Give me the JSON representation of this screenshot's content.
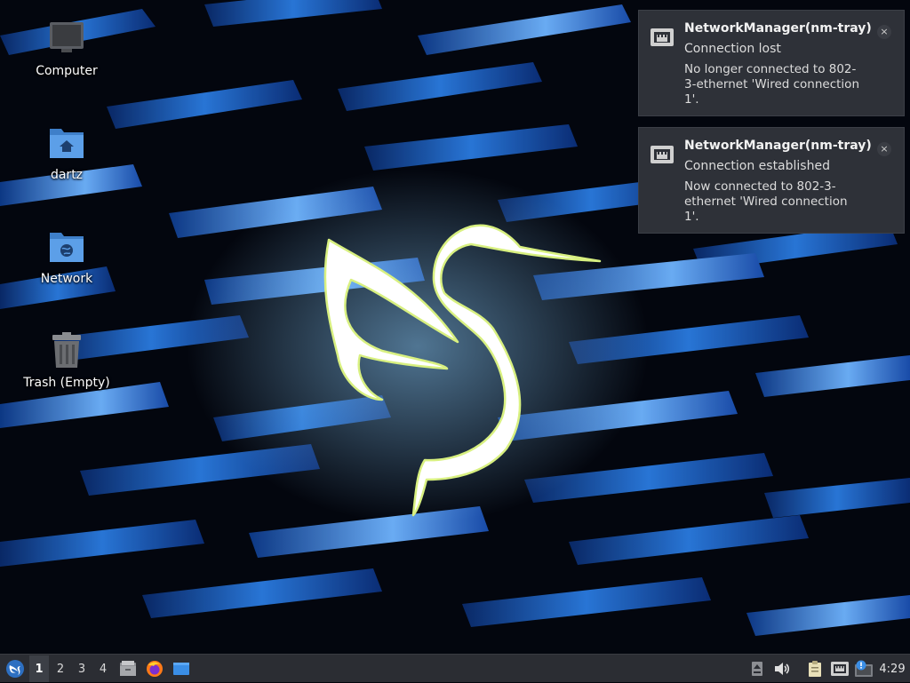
{
  "desktop": {
    "icons": [
      {
        "label": "Computer",
        "icon": "computer-icon"
      },
      {
        "label": "dartz",
        "icon": "home-folder-icon"
      },
      {
        "label": "Network",
        "icon": "network-folder-icon"
      },
      {
        "label": "Trash (Empty)",
        "icon": "trash-icon"
      }
    ]
  },
  "notifications": [
    {
      "app": "NetworkManager(nm-tray)",
      "summary": "Connection lost",
      "body": "No longer connected to 802-3-ethernet 'Wired connection 1'.",
      "close": "×",
      "icon": "wired-network-icon"
    },
    {
      "app": "NetworkManager(nm-tray)",
      "summary": "Connection established",
      "body": "Now connected to 802-3-ethernet 'Wired connection 1'.",
      "close": "×",
      "icon": "wired-network-icon"
    }
  ],
  "taskbar": {
    "desktops": [
      "1",
      "2",
      "3",
      "4"
    ],
    "active_desktop": "1",
    "launchers": [
      "file-manager-icon",
      "firefox-icon",
      "show-desktop-icon"
    ],
    "tray": [
      "upload-indicator-icon",
      "volume-icon",
      "clipboard-icon",
      "wired-network-icon",
      "update-notifier-icon"
    ],
    "clock": "4:29"
  },
  "colors": {
    "accent": "#3b82d6",
    "notification_bg": "#2e3138",
    "taskbar_bg": "#2b2d33"
  }
}
